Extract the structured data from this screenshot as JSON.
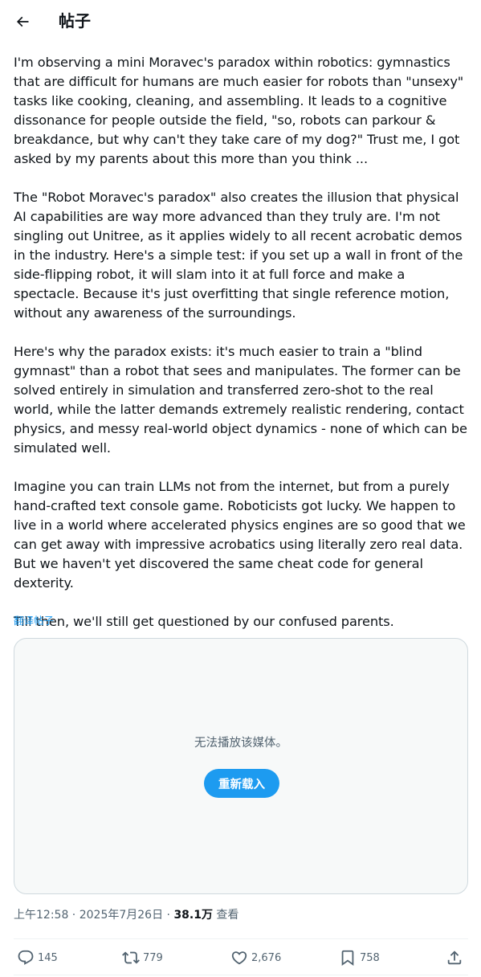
{
  "header": {
    "back_icon": "arrow-left-icon",
    "title": "帖子"
  },
  "post": {
    "paragraphs": [
      "I'm observing a mini Moravec's paradox within robotics: gymnastics that are difficult for humans are much easier for robots than \"unsexy\" tasks like cooking, cleaning, and assembling. It leads to a cognitive dissonance for people outside the field, \"so, robots can parkour & breakdance, but why can't they take care of my dog?\" Trust me, I got asked by my parents about this more than you think ...",
      "The \"Robot Moravec's paradox\" also creates the illusion that physical AI capabilities are way more advanced than they truly are. I'm not singling out Unitree, as it applies widely to all recent acrobatic demos in the industry. Here's a simple test: if you set up a wall in front of the side-flipping robot, it will slam into it at full force and make a spectacle. Because it's just overfitting that single reference motion, without any awareness of the surroundings.",
      "Here's why the paradox exists: it's much easier to train a \"blind gymnast\" than a robot that sees and manipulates. The former can be solved entirely in simulation and transferred zero-shot to the real world, while the latter demands extremely realistic rendering, contact physics, and messy real-world object dynamics - none of which can be simulated well.",
      "Imagine you can train LLMs not from the internet, but from a purely hand-crafted text console game. Roboticists got lucky. We happen to live in a world where accelerated physics engines are so good that we can get away with impressive acrobatics using literally zero real data. But we haven't yet discovered the same cheat code for general dexterity.",
      "Till then, we'll still get questioned by our confused parents."
    ],
    "translate_label": "翻译帖子"
  },
  "media": {
    "error_text": "无法播放该媒体。",
    "reload_label": "重新载入"
  },
  "meta": {
    "time": "上午12:58",
    "separator": " · ",
    "date": "2025年7月26日",
    "views_count": "38.1万",
    "views_label": " 查看"
  },
  "actions": {
    "reply_count": "145",
    "repost_count": "779",
    "like_count": "2,676",
    "bookmark_count": "758",
    "icons": [
      "reply-icon",
      "repost-icon",
      "like-icon",
      "bookmark-icon",
      "share-icon"
    ]
  },
  "colors": {
    "accent": "#1d9bf0",
    "text_primary": "#0f1419",
    "text_secondary": "#536471",
    "border": "#cfd9de",
    "media_bg": "#f7f9f9"
  }
}
